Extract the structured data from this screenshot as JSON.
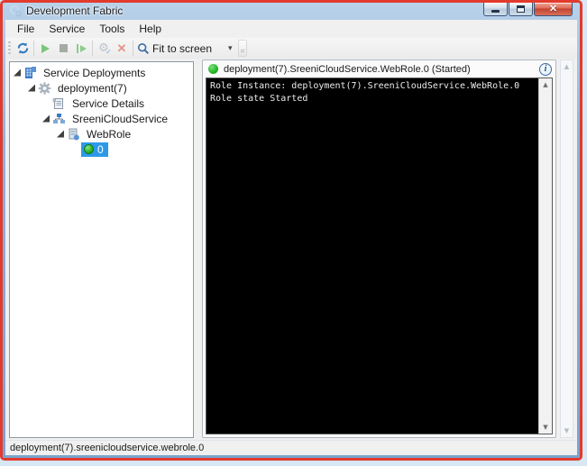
{
  "window": {
    "title": "Development Fabric"
  },
  "titlebar_buttons": {
    "close_glyph": "✕"
  },
  "menu": {
    "items": [
      {
        "label": "File"
      },
      {
        "label": "Service"
      },
      {
        "label": "Tools"
      },
      {
        "label": "Help"
      }
    ]
  },
  "toolbar": {
    "buttons": [
      "refresh",
      "start",
      "stop",
      "step",
      "settings-check",
      "remove"
    ],
    "zoom_selector": {
      "value": "Fit to screen"
    },
    "caret_glyph": "▾"
  },
  "tree": {
    "items": [
      {
        "label": "Service Deployments",
        "icon": "service-deployments-icon",
        "level": 0,
        "expanded": true,
        "selected": false
      },
      {
        "label": "deployment(7)",
        "icon": "deployment-gear-icon",
        "level": 1,
        "expanded": true,
        "selected": false
      },
      {
        "label": "Service Details",
        "icon": "service-details-icon",
        "level": 2,
        "expanded": false,
        "selected": false
      },
      {
        "label": "SreeniCloudService",
        "icon": "cloud-service-icon",
        "level": 2,
        "expanded": true,
        "selected": false
      },
      {
        "label": "WebRole",
        "icon": "web-role-icon",
        "level": 3,
        "expanded": true,
        "selected": false
      },
      {
        "label": "0",
        "icon": "instance-dot-icon",
        "level": 4,
        "expanded": false,
        "selected": true
      }
    ]
  },
  "instance_panel": {
    "status": "running",
    "status_dot_color": "#28b828",
    "title": "deployment(7).SreeniCloudService.WebRole.0 (Started)",
    "info_glyph": "i",
    "console": {
      "lines": [
        "Role Instance: deployment(7).SreeniCloudService.WebRole.0",
        "Role state Started"
      ]
    }
  },
  "scrollbars": {
    "up_glyph": "▲",
    "down_glyph": "▼"
  },
  "status_bar": {
    "text": "deployment(7).sreenicloudservice.webrole.0"
  },
  "colors": {
    "selection": "#2c99e8",
    "annotation_border": "#e23b2e",
    "console_bg": "#000000",
    "titlebar_blue": "#8fb2d6"
  }
}
